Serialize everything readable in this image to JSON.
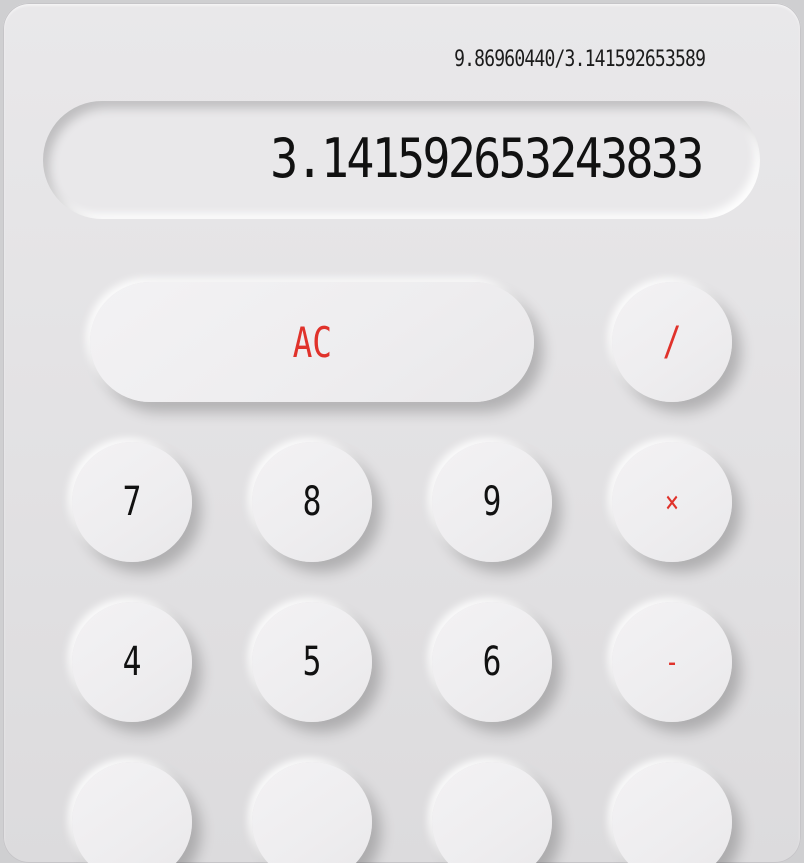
{
  "display": {
    "expression": "9.86960440/3.141592653589",
    "result": "3.141592653243833"
  },
  "keys": {
    "ac": "AC",
    "divide": "/",
    "seven": "7",
    "eight": "8",
    "nine": "9",
    "multiply": "×",
    "four": "4",
    "five": "5",
    "six": "6",
    "minus": "-"
  },
  "colors": {
    "body": "#e6e5e7",
    "key_face": "#f0eff1",
    "digit_text": "#111111",
    "operator_text": "#e0322b"
  }
}
